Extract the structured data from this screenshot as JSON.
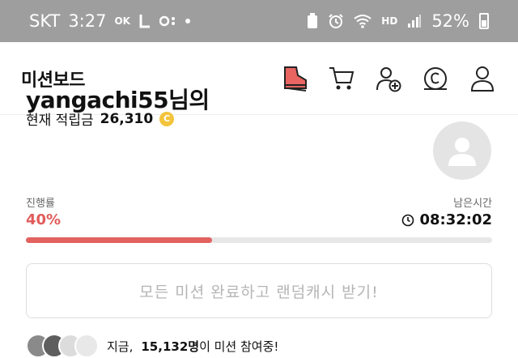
{
  "status_bar": {
    "carrier": "SKT",
    "time": "3:27",
    "ok_label": "OK",
    "battery_percent": "52%",
    "hd_label": "HD"
  },
  "header": {
    "title": "미션보드",
    "icons": [
      "shoe-icon",
      "cart-icon",
      "add-user-icon",
      "coin-c-icon",
      "profile-icon"
    ]
  },
  "profile": {
    "username_line": "yangachi55님의",
    "balance_label": "현재 적립금",
    "balance_amount": "26,310",
    "coin_symbol": "C"
  },
  "progress": {
    "label": "진행률",
    "percent_text": "40%",
    "fraction": 0.4,
    "time_label": "남은시간",
    "time_remaining": "08:32:02",
    "accent_color": "#e2625f"
  },
  "reward_button": {
    "label": "모든 미션 완료하고 랜덤캐시 받기!"
  },
  "participants": {
    "prefix": "지금,",
    "count": "15,132명",
    "suffix": "이 미션 참여중!"
  }
}
